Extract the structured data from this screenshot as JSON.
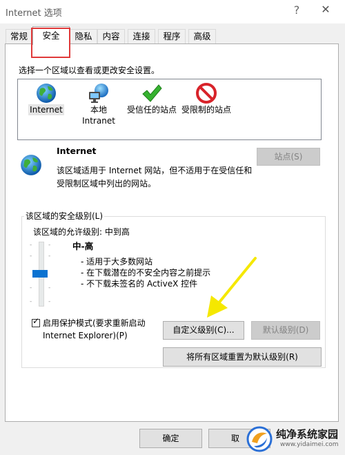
{
  "window": {
    "title": "Internet 选项",
    "help_label": "?",
    "close_label": "✕"
  },
  "tabs": [
    {
      "label": "常规"
    },
    {
      "label": "安全"
    },
    {
      "label": "隐私"
    },
    {
      "label": "内容"
    },
    {
      "label": "连接"
    },
    {
      "label": "程序"
    },
    {
      "label": "高级"
    }
  ],
  "security": {
    "prompt": "选择一个区域以查看或更改安全设置。",
    "zones": [
      {
        "label": "Internet",
        "icon": "globe-icon"
      },
      {
        "label": "本地\nIntranet",
        "icon": "intranet-icon"
      },
      {
        "label": "受信任的站点",
        "icon": "check-icon"
      },
      {
        "label": "受限制的站点",
        "icon": "restricted-icon"
      }
    ],
    "zone_info": {
      "title": "Internet",
      "description": "该区域适用于 Internet 网站，但不适用于在受信任和受限制区域中列出的网站。",
      "sites_button": "站点(S)"
    },
    "level_group": {
      "legend": "该区域的安全级别(L)",
      "allowed": "该区域的允许级别: 中到高",
      "level_name": "中-高",
      "bullets": [
        "- 适用于大多数网站",
        "- 在下载潜在的不安全内容之前提示",
        "- 不下载未签名的 ActiveX 控件"
      ],
      "slider_level": "3 of 5",
      "protected_mode_label": "启用保护模式(要求重新启动 Internet Explorer)(P)",
      "protected_mode_checked": true,
      "custom_button": "自定义级别(C)...",
      "default_button": "默认级别(D)"
    },
    "reset_all_button": "将所有区域重置为默认级别(R)"
  },
  "footer": {
    "ok_button": "确定",
    "cancel_button": "取"
  },
  "watermark": {
    "brand": "纯净系统家园",
    "url": "www.yidaimei.com"
  },
  "colors": {
    "accent": "#0a72d1",
    "highlight_box": "#e03a3a",
    "arrow": "#f5e800"
  }
}
